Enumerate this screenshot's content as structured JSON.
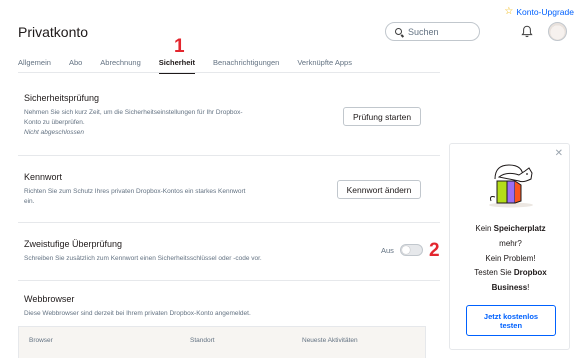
{
  "header": {
    "upgrade_link": "Konto-Upgrade",
    "title": "Privatkonto",
    "search_placeholder": "Suchen"
  },
  "tabs": [
    {
      "label": "Allgemein"
    },
    {
      "label": "Abo"
    },
    {
      "label": "Abrechnung"
    },
    {
      "label": "Sicherheit",
      "active": true
    },
    {
      "label": "Benachrichtigungen"
    },
    {
      "label": "Verknüpfte Apps"
    }
  ],
  "annotations": {
    "one": "1",
    "two": "2"
  },
  "sections": {
    "security_check": {
      "title": "Sicherheitsprüfung",
      "desc": "Nehmen Sie sich kurz Zeit, um die Sicherheitseinstellungen für Ihr Dropbox-Konto zu überprüfen.",
      "status": "Nicht abgeschlossen",
      "button": "Prüfung starten"
    },
    "password": {
      "title": "Kennwort",
      "desc": "Richten Sie zum Schutz Ihres privaten Dropbox-Kontos ein starkes Kennwort ein.",
      "button": "Kennwort ändern"
    },
    "two_step": {
      "title": "Zweistufige Überprüfung",
      "desc": "Schreiben Sie zusätzlich zum Kennwort einen Sicherheitsschlüssel oder -code vor.",
      "toggle_label": "Aus",
      "toggle_on": false
    },
    "browsers": {
      "title": "Webbrowser",
      "desc": "Diese Webbrowser sind derzeit bei Ihrem privaten Dropbox-Konto angemeldet.",
      "columns": [
        "Browser",
        "Standort",
        "Neueste Aktivitäten"
      ]
    }
  },
  "promo": {
    "line1_a": "Kein ",
    "line1_b": "Speicherplatz",
    "line2": "mehr?",
    "line3": "Kein Problem!",
    "line4_a": "Testen Sie ",
    "line4_b": "Dropbox",
    "line5_a": "Business",
    "line5_b": "!",
    "cta": "Jetzt kostenlos testen"
  },
  "colors": {
    "accent": "#0061fe",
    "annotation": "#e3262e",
    "star": "#f0b400"
  }
}
